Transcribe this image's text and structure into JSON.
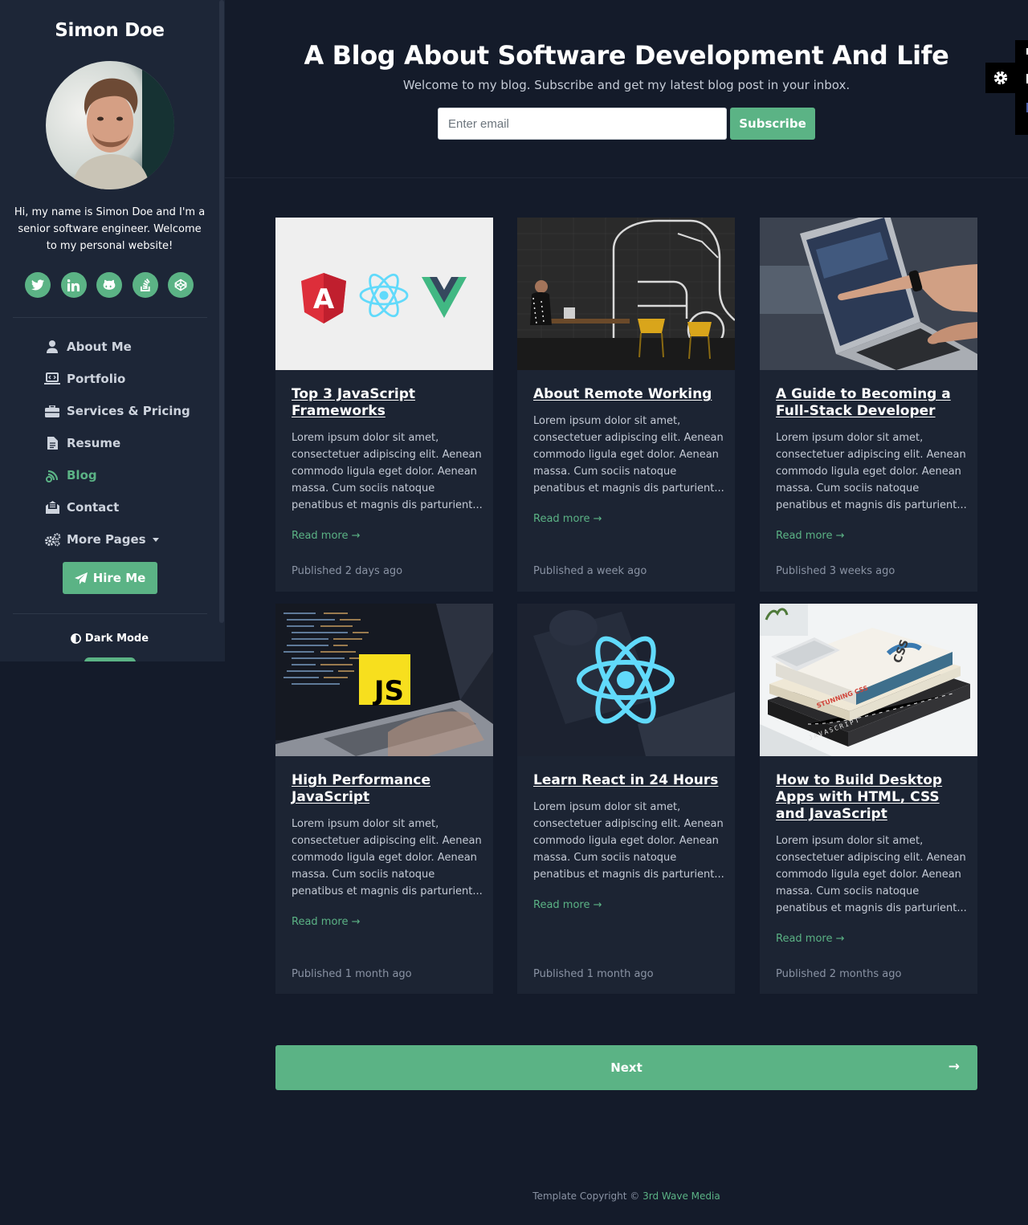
{
  "sidebar": {
    "brand": "Simon Doe",
    "bio": "Hi, my name is Simon Doe and I'm a senior software engineer. Welcome to my personal website!",
    "social": [
      {
        "icon": "twitter-icon"
      },
      {
        "icon": "linkedin-icon"
      },
      {
        "icon": "github-icon"
      },
      {
        "icon": "stack-overflow-icon"
      },
      {
        "icon": "codepen-icon"
      }
    ],
    "nav": [
      {
        "label": "About Me",
        "icon": "user-icon"
      },
      {
        "label": "Portfolio",
        "icon": "laptop-code-icon"
      },
      {
        "label": "Services & Pricing",
        "icon": "briefcase-icon"
      },
      {
        "label": "Resume",
        "icon": "file-alt-icon"
      },
      {
        "label": "Blog",
        "icon": "blog-icon",
        "active": true
      },
      {
        "label": "Contact",
        "icon": "envelope-open-text-icon"
      },
      {
        "label": "More Pages",
        "icon": "cogs-icon"
      }
    ],
    "hire_label": "Hire Me",
    "dark_mode_label": "Dark Mode"
  },
  "header": {
    "title": "A Blog About Software Development And Life",
    "intro": "Welcome to my blog. Subscribe and get my latest blog post in your inbox.",
    "email_placeholder": "Enter email",
    "subscribe_label": "Subscribe"
  },
  "posts": [
    {
      "title": "Top 3 JavaScript Frameworks",
      "excerpt": "Lorem ipsum dolor sit amet, consectetuer adipiscing elit. Aenean commodo ligula eget dolor. Aenean massa. Cum sociis natoque penatibus et magnis dis parturient...",
      "read_more": "Read more →",
      "published": "Published 2 days ago"
    },
    {
      "title": "About Remote Working",
      "excerpt": "Lorem ipsum dolor sit amet, consectetuer adipiscing elit. Aenean commodo ligula eget dolor. Aenean massa. Cum sociis natoque penatibus et magnis dis parturient...",
      "read_more": "Read more →",
      "published": "Published a week ago"
    },
    {
      "title": "A Guide to Becoming a Full-Stack Developer",
      "excerpt": "Lorem ipsum dolor sit amet, consectetuer adipiscing elit. Aenean commodo ligula eget dolor. Aenean massa. Cum sociis natoque penatibus et magnis dis parturient...",
      "read_more": "Read more →",
      "published": "Published 3 weeks ago"
    },
    {
      "title": "High Performance JavaScript",
      "excerpt": "Lorem ipsum dolor sit amet, consectetuer adipiscing elit. Aenean commodo ligula eget dolor. Aenean massa. Cum sociis natoque penatibus et magnis dis parturient...",
      "read_more": "Read more →",
      "published": "Published 1 month ago"
    },
    {
      "title": "Learn React in 24 Hours",
      "excerpt": "Lorem ipsum dolor sit amet, consectetuer adipiscing elit. Aenean commodo ligula eget dolor. Aenean massa. Cum sociis natoque penatibus et magnis dis parturient...",
      "read_more": "Read more →",
      "published": "Published 1 month ago"
    },
    {
      "title": "How to Build Desktop Apps with HTML, CSS and JavaScript",
      "excerpt": "Lorem ipsum dolor sit amet, consectetuer adipiscing elit. Aenean commodo ligula eget dolor. Aenean massa. Cum sociis natoque penatibus et magnis dis parturient...",
      "read_more": "Read more →",
      "published": "Published 2 months ago"
    }
  ],
  "thumb_text": {
    "angular_letter": "A",
    "js_badge": "JS",
    "book_top": "CSS",
    "book_middle": "STUNNING CSS",
    "book_bottom": "JAVASCRIPT"
  },
  "pager": {
    "next_label": "Next",
    "next_arrow": "→"
  },
  "footer": {
    "prefix": "Template Copyright © ",
    "link": "3rd Wave Media"
  },
  "colors": {
    "accent": "#5bb385",
    "page_bg": "#141b2a",
    "sidebar_bg": "#1d2637",
    "card_bg": "#1c2433"
  }
}
